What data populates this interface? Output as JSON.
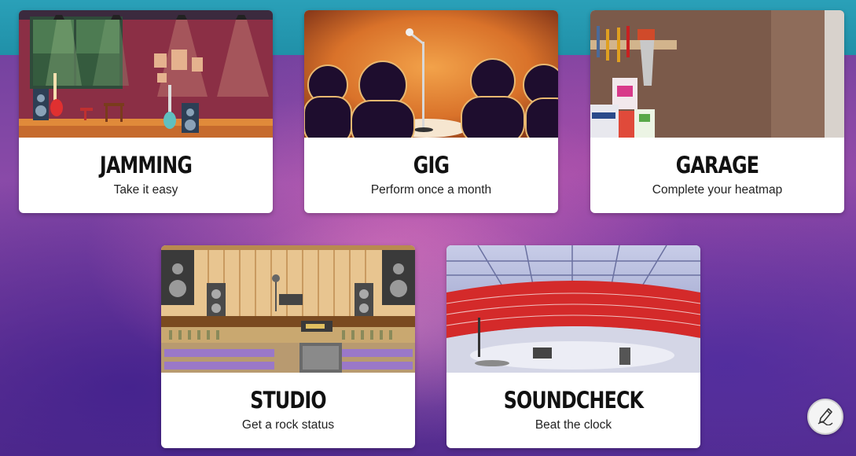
{
  "cards": [
    {
      "title": "JAMMING",
      "subtitle": "Take it easy"
    },
    {
      "title": "GIG",
      "subtitle": "Perform once a month"
    },
    {
      "title": "GARAGE",
      "subtitle": "Complete your heatmap"
    },
    {
      "title": "STUDIO",
      "subtitle": "Get a rock status"
    },
    {
      "title": "SOUNDCHECK",
      "subtitle": "Beat the clock"
    }
  ],
  "fab": {
    "icon": "pen-icon"
  }
}
